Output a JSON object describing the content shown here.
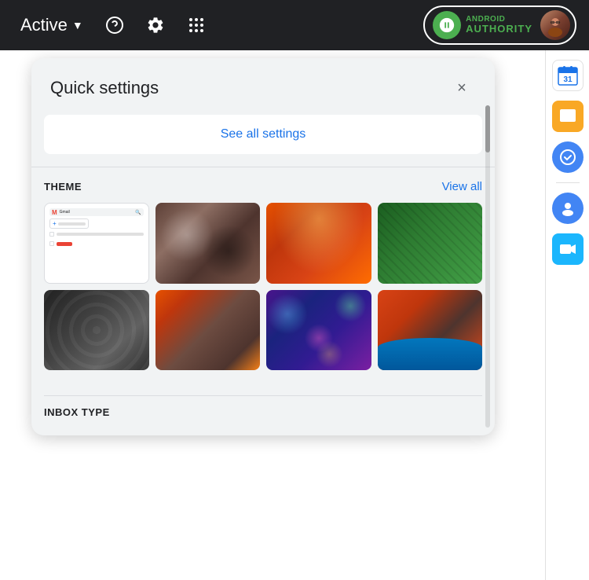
{
  "topbar": {
    "active_label": "Active",
    "chevron": "▼",
    "help_icon": "?",
    "settings_icon": "⚙",
    "grid_icon": "⠿",
    "brand": {
      "name": "ANDROID\nAUTHORITY",
      "line1": "ANDROID",
      "line2": "AUTHORITY"
    }
  },
  "quick_settings": {
    "title": "Quick settings",
    "close_label": "×",
    "see_all_settings": "See all settings",
    "theme_label": "THEME",
    "view_all_label": "View all",
    "inbox_type_label": "INBOX TYPE",
    "themes": [
      {
        "id": "gmail-default",
        "name": "Gmail default"
      },
      {
        "id": "chess",
        "name": "Chess"
      },
      {
        "id": "canyon",
        "name": "Canyon"
      },
      {
        "id": "plant",
        "name": "Green plant"
      },
      {
        "id": "metallic",
        "name": "Metallic"
      },
      {
        "id": "autumn",
        "name": "Autumn leaves"
      },
      {
        "id": "bokeh",
        "name": "Bokeh"
      },
      {
        "id": "horseshoe",
        "name": "Horseshoe Bend"
      }
    ]
  },
  "sidebar": {
    "apps": [
      {
        "id": "calendar",
        "color": "#1a73e8",
        "label": "31"
      },
      {
        "id": "chat",
        "color": "#f9a825"
      },
      {
        "id": "tasks",
        "color": "#1a73e8"
      },
      {
        "id": "contacts",
        "color": "#1a73e8"
      },
      {
        "id": "meet",
        "color": "#1bb6fd"
      }
    ]
  }
}
